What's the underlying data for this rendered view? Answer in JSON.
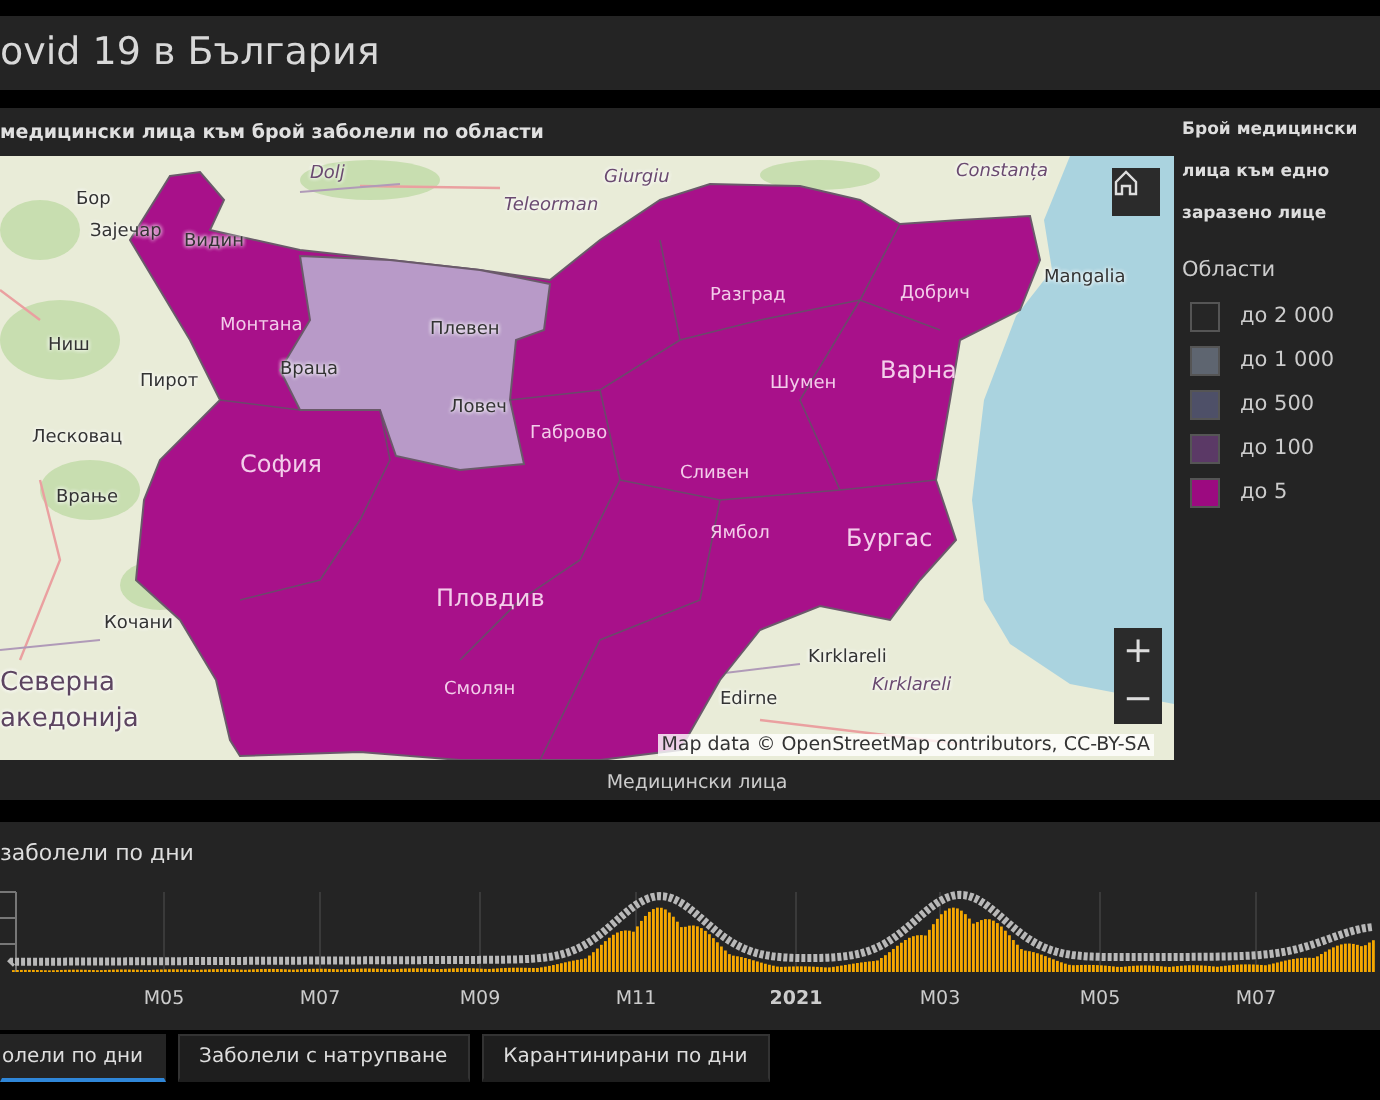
{
  "header": {
    "title": "ovid 19 в България"
  },
  "map_panel": {
    "title": "медицински лица към брой заболели по области",
    "caption": "Медицински лица",
    "attribution": "Map data © OpenStreetMap contributors, CC-BY-SA",
    "zoom_in": "+",
    "zoom_out": "−",
    "labels": [
      {
        "text": "Бор",
        "kind": "place"
      },
      {
        "text": "Зајечар",
        "kind": "place"
      },
      {
        "text": "Видин",
        "kind": "place"
      },
      {
        "text": "Dolj",
        "kind": "region"
      },
      {
        "text": "Teleorman",
        "kind": "region"
      },
      {
        "text": "Giurgiu",
        "kind": "region"
      },
      {
        "text": "Constanța",
        "kind": "region"
      },
      {
        "text": "Ниш",
        "kind": "place"
      },
      {
        "text": "Пирот",
        "kind": "place"
      },
      {
        "text": "Лесковац",
        "kind": "place"
      },
      {
        "text": "Врање",
        "kind": "place"
      },
      {
        "text": "Монтана",
        "kind": "faint"
      },
      {
        "text": "Враца",
        "kind": "place"
      },
      {
        "text": "Плевен",
        "kind": "place"
      },
      {
        "text": "Ловеч",
        "kind": "place"
      },
      {
        "text": "Габрово",
        "kind": "faint"
      },
      {
        "text": "София",
        "kind": "faint-big"
      },
      {
        "text": "Пловдив",
        "kind": "faint-big"
      },
      {
        "text": "Смолян",
        "kind": "faint"
      },
      {
        "text": "Разград",
        "kind": "faint"
      },
      {
        "text": "Добрич",
        "kind": "faint"
      },
      {
        "text": "Шумен",
        "kind": "faint"
      },
      {
        "text": "Варна",
        "kind": "faint-big"
      },
      {
        "text": "Сливен",
        "kind": "faint"
      },
      {
        "text": "Ямбол",
        "kind": "faint"
      },
      {
        "text": "Бургас",
        "kind": "faint-big"
      },
      {
        "text": "Mangalia",
        "kind": "place"
      },
      {
        "text": "Кочани",
        "kind": "place"
      },
      {
        "text": "Северна",
        "kind": "big"
      },
      {
        "text": "акедонија",
        "kind": "big"
      },
      {
        "text": "Kırklareli",
        "kind": "place"
      },
      {
        "text": "Kırklareli",
        "kind": "region"
      },
      {
        "text": "Edirne",
        "kind": "place"
      }
    ]
  },
  "legend": {
    "title_lines": [
      "Брой медицински",
      "лица към едно",
      "заразено лице"
    ],
    "subtitle": "Области",
    "items": [
      {
        "label": "до 2 000",
        "color": "#262626"
      },
      {
        "label": "до 1 000",
        "color": "#5e6570"
      },
      {
        "label": "до 500",
        "color": "#4e5068"
      },
      {
        "label": "до 100",
        "color": "#5b3966"
      },
      {
        "label": "до 5",
        "color": "#9c0a80"
      }
    ]
  },
  "chart_panel": {
    "title": "заболели по дни",
    "axis_labels": [
      {
        "text": "M05",
        "bold": false
      },
      {
        "text": "M07",
        "bold": false
      },
      {
        "text": "M09",
        "bold": false
      },
      {
        "text": "M11",
        "bold": false
      },
      {
        "text": "2021",
        "bold": true
      },
      {
        "text": "M03",
        "bold": false
      },
      {
        "text": "M05",
        "bold": false
      },
      {
        "text": "M07",
        "bold": false
      }
    ]
  },
  "tabs": [
    {
      "label": "олели по дни",
      "selected": true
    },
    {
      "label": "Заболели с натрупване",
      "selected": false
    },
    {
      "label": "Карантинирани по дни",
      "selected": false
    }
  ]
}
